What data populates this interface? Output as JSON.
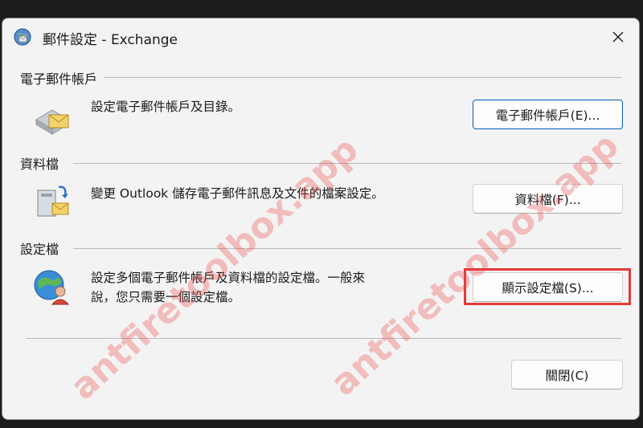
{
  "window": {
    "title": "郵件設定 - Exchange"
  },
  "sections": {
    "email": {
      "heading": "電子郵件帳戶",
      "description": "設定電子郵件帳戶及目錄。",
      "button": "電子郵件帳戶(E)..."
    },
    "datafile": {
      "heading": "資料檔",
      "description": "變更 Outlook 儲存電子郵件訊息及文件的檔案設定。",
      "button": "資料檔(F)..."
    },
    "profile": {
      "heading": "設定檔",
      "description_line1": "設定多個電子郵件帳戶及資料檔的設定檔。一般來",
      "description_line2": "說，您只需要一個設定檔。",
      "button": "顯示設定檔(S)..."
    }
  },
  "footer": {
    "close_button": "關閉(C)"
  },
  "watermark": {
    "text": "antfiretoolbox.app"
  },
  "colors": {
    "highlight": "#e23a3a",
    "default_button_border": "#005fb8"
  }
}
